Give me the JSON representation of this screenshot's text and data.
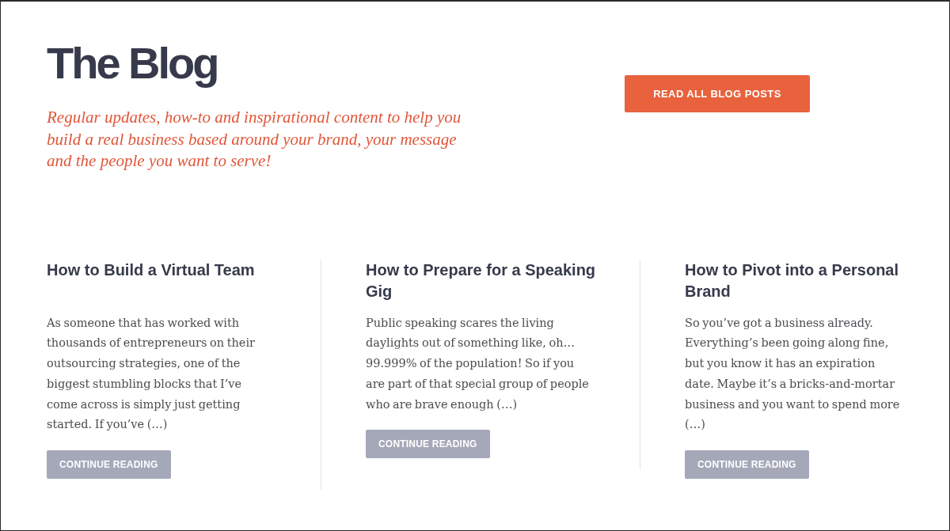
{
  "header": {
    "title": "The Blog",
    "tagline": "Regular updates, how-to and inspirational content to help you build a real business based around your brand, your message and the people you want to serve!",
    "button": "READ ALL BLOG POSTS"
  },
  "posts": [
    {
      "title": "How to Build a Virtual Team",
      "excerpt": "As someone that has worked with thousands of entrepreneurs on their outsourcing strategies, one of the biggest stumbling blocks that I’ve come across is simply just getting started. If you’ve (…)",
      "button": "CONTINUE READING"
    },
    {
      "title": "How to Prepare for a Speaking Gig",
      "excerpt": "Public speaking scares the living daylights out of something like, oh… 99.999% of the population! So if you are part of that special group of people who are brave enough (…)",
      "button": "CONTINUE READING"
    },
    {
      "title": "How to Pivot into a Personal Brand",
      "excerpt": "So you’ve got a business already. Everything’s been going along fine, but you know it has an expiration date. Maybe it’s a bricks-and-mortar business and you want to spend more (…)",
      "button": "CONTINUE READING"
    }
  ]
}
